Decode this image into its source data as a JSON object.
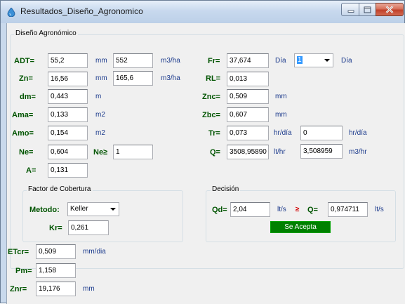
{
  "window": {
    "title": "Resultados_Diseño_Agronomico",
    "colors": {
      "label": "#005400",
      "unit": "#1b3a8c",
      "accept": "#008000",
      "compare": "#d40000"
    }
  },
  "main_group": {
    "title": "Diseño Agronómico"
  },
  "left": {
    "adt": {
      "label": "ADT=",
      "value": "55,2",
      "unit": "mm",
      "value2": "552",
      "unit2": "m3/ha"
    },
    "zn": {
      "label": "Zn=",
      "value": "16,56",
      "unit": "mm",
      "value2": "165,6",
      "unit2": "m3/ha"
    },
    "dm": {
      "label": "dm=",
      "value": "0,443",
      "unit": "m"
    },
    "ama": {
      "label": "Ama=",
      "value": "0,133",
      "unit": "m2"
    },
    "amo": {
      "label": "Amo=",
      "value": "0,154",
      "unit": "m2"
    },
    "ne": {
      "label": "Ne=",
      "value": "0,604",
      "label2": "Ne≥",
      "value2": "1"
    },
    "a": {
      "label": "A=",
      "value": "0,131"
    }
  },
  "right": {
    "fr": {
      "label": "Fr=",
      "value": "37,674",
      "unit": "Día",
      "combo_value": "1",
      "unit2": "Día"
    },
    "rl": {
      "label": "RL=",
      "value": "0,013"
    },
    "znc": {
      "label": "Znc=",
      "value": "0,509",
      "unit": "mm"
    },
    "zbc": {
      "label": "Zbc=",
      "value": "0,607",
      "unit": "mm"
    },
    "tr": {
      "label": "Tr=",
      "value": "0,073",
      "unit": "hr/día",
      "value2": "0",
      "unit2": "hr/día"
    },
    "q": {
      "label": "Q=",
      "value": "3508,95890",
      "unit": "lt/hr",
      "value2": "3,508959",
      "unit2": "m3/hr"
    }
  },
  "factor_group": {
    "title": "Factor de Cobertura",
    "metodo_label": "Metodo:",
    "metodo_value": "Keller",
    "kr_label": "Kr=",
    "kr_value": "0,261"
  },
  "decision_group": {
    "title": "Decisión",
    "qd_label": "Qd=",
    "qd_value": "2,04",
    "qd_unit": "lt/s",
    "compare": "≥",
    "q_label": "Q=",
    "q_value": "0,974711",
    "q_unit": "lt/s",
    "result": "Se Acepta"
  },
  "bottom": {
    "etcr": {
      "label": "ETcr=",
      "value": "0,509",
      "unit": "mm/dia"
    },
    "pm": {
      "label": "Pm=",
      "value": "1,158"
    },
    "znr": {
      "label": "Znr=",
      "value": "19,176",
      "unit": "mm"
    }
  }
}
